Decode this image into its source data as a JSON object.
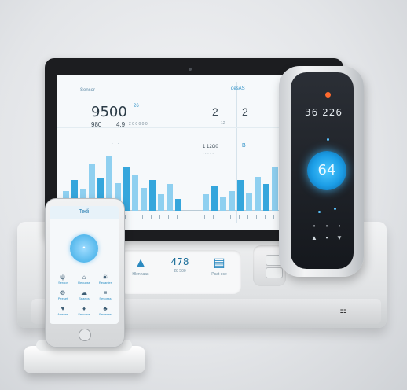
{
  "colors": {
    "accent_blue": "#35a6dc",
    "light_blue": "#8fd0f0",
    "thermo_glow": "#2aa8ef",
    "led_orange": "#ff6a2e"
  },
  "tablet": {
    "left_panel": {
      "label": "Sensor",
      "main_value": "9500",
      "main_unit": "26",
      "sub_value_a": "980",
      "sub_value_b": "4.9",
      "sub_text": "2 0 0 0 0 0",
      "axis_note": "· · ·"
    },
    "right_panel": {
      "label": "desAS",
      "value_a": "2",
      "value_b": "2",
      "note_a": "· 12 ·",
      "note_b": "1 12G0",
      "note_c": "· · · · ·",
      "flag": "B"
    },
    "bars_left": [
      0.35,
      0.55,
      0.4,
      0.85,
      0.6,
      1.0,
      0.5,
      0.78,
      0.65,
      0.42,
      0.55,
      0.3,
      0.48,
      0.22
    ],
    "bars_right": [
      0.3,
      0.45,
      0.25,
      0.35,
      0.55,
      0.32,
      0.62,
      0.48,
      0.8,
      0.38,
      0.95,
      0.6,
      0.72,
      0.45
    ]
  },
  "base": {
    "panel": [
      {
        "icon": "shield-icon",
        "glyph": "▲",
        "value": "",
        "label": "Hlennaas"
      },
      {
        "icon": "temp-icon",
        "glyph": "",
        "value": "478",
        "label": "28 500"
      },
      {
        "icon": "device-icon",
        "glyph": "▤",
        "value": "",
        "label": "Pcat ese"
      }
    ],
    "logo": "☷"
  },
  "thermostat": {
    "top_readout": "36 226",
    "ring_value": "64",
    "buttons": [
      "•",
      "•",
      "•",
      "▲",
      "•",
      "▼"
    ]
  },
  "phone": {
    "header": "Tedi",
    "dial_value": "•",
    "grid": [
      [
        {
          "icon": "ψ",
          "label": "Seroor"
        },
        {
          "icon": "⌂",
          "label": "Recuose"
        },
        {
          "icon": "☀",
          "label": "Recanter"
        }
      ],
      [
        {
          "icon": "⚙",
          "label": "Peeset"
        },
        {
          "icon": "☁",
          "label": "Seaeos"
        },
        {
          "icon": "≡",
          "label": "Sesoess"
        }
      ],
      [
        {
          "icon": "♥",
          "label": "Aeecee"
        },
        {
          "icon": "♦",
          "label": "Seocons"
        },
        {
          "icon": "♣",
          "label": "Pecesee"
        }
      ]
    ]
  }
}
